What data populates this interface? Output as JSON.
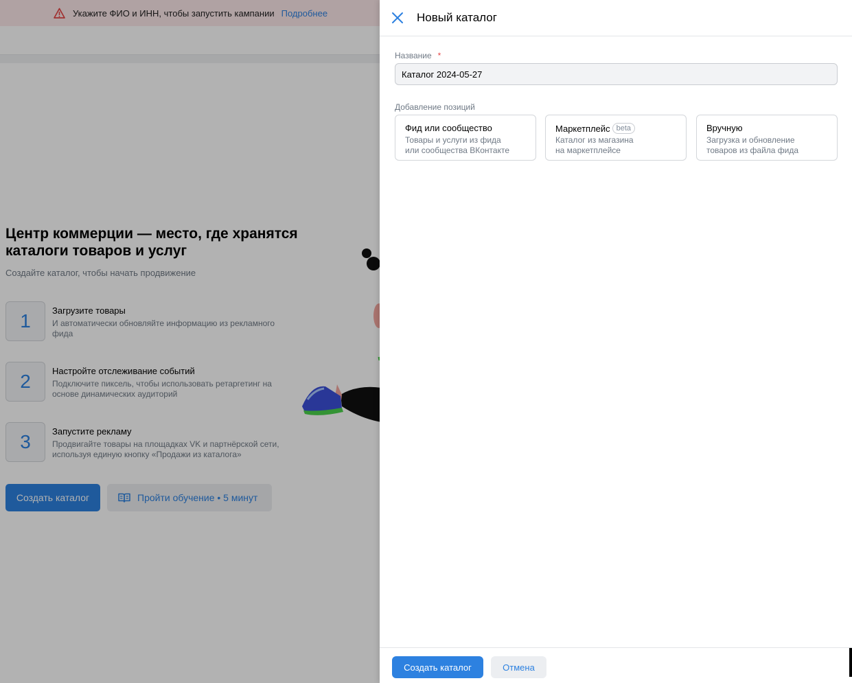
{
  "warning": {
    "text": "Укажите ФИО и ИНН, чтобы запустить кампании",
    "link": "Подробнее"
  },
  "background": {
    "hero_title": "Центр коммерции — место, где хранятся каталоги товаров и услуг",
    "hero_subtitle": "Создайте каталог, чтобы начать продвижение",
    "steps": [
      {
        "num": "1",
        "title": "Загрузите товары",
        "desc": "И автоматически обновляйте информацию из рекламного фида"
      },
      {
        "num": "2",
        "title": "Настройте отслеживание событий",
        "desc": "Подключите пиксель, чтобы использовать ретаргетинг на основе динамических аудиторий"
      },
      {
        "num": "3",
        "title": "Запустите рекламу",
        "desc": "Продвигайте товары на площадках VK и партнёрской сети, используя единую кнопку «Продажи из каталога»"
      }
    ],
    "create_button": "Создать каталог",
    "learn_button": "Пройти обучение • 5 минут"
  },
  "panel": {
    "title": "Новый каталог",
    "name_label": "Название",
    "required_mark": "*",
    "name_value": "Каталог 2024-05-27",
    "add_label": "Добавление позиций",
    "options": [
      {
        "title": "Фид или сообщество",
        "badge": "",
        "desc": "Товары и услуги из фида\nили сообщества ВКонтакте"
      },
      {
        "title": "Маркетплейс",
        "badge": "beta",
        "desc": "Каталог из магазина\nна маркетплейсе"
      },
      {
        "title": "Вручную",
        "badge": "",
        "desc": "Загрузка и обновление\nтоваров из файла фида"
      }
    ],
    "footer": {
      "create": "Создать каталог",
      "cancel": "Отмена"
    }
  },
  "colors": {
    "accent": "#2d81e0",
    "warning_bg": "#fde8ea",
    "warning_icon": "#e64646",
    "overlay": "rgba(0,0,0,0.30)"
  }
}
